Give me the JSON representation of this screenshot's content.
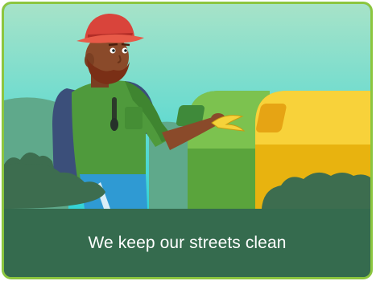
{
  "card": {
    "caption": "We keep our streets clean",
    "illustration": "man-recycling-banana-peel-illustration"
  },
  "colors": {
    "border": "#8cc63f",
    "caption_background": "#356b4e",
    "caption_text": "#ffffff",
    "sky_top": "#a7e3c8",
    "sky_bottom": "#34d4d6",
    "bin_green": "#6bb44a",
    "bin_yellow": "#f4c218",
    "bush": "#3d6d4f"
  }
}
